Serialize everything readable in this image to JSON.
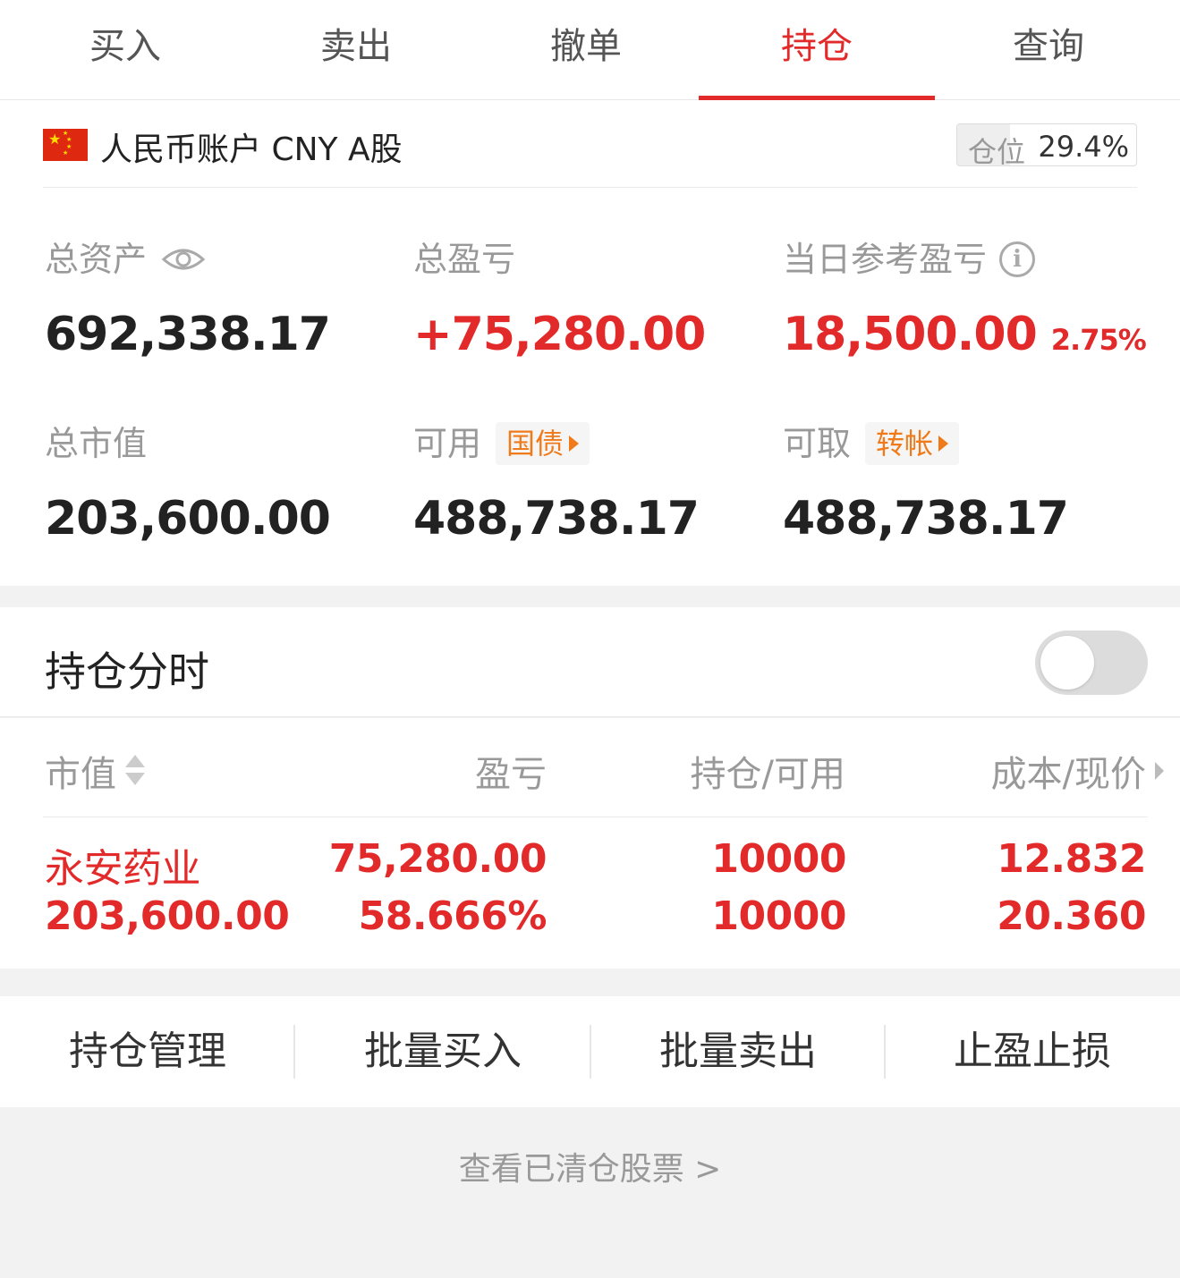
{
  "tabs": [
    {
      "label": "买入"
    },
    {
      "label": "卖出"
    },
    {
      "label": "撤单"
    },
    {
      "label": "持仓",
      "active": true
    },
    {
      "label": "查询"
    }
  ],
  "account": {
    "name": "人民币账户 CNY A股",
    "flag_icon": "china-flag-icon",
    "position_label": "仓位",
    "position_value": "29.4%",
    "position_ratio": 0.294
  },
  "stats": {
    "total_assets": {
      "label": "总资产",
      "value": "692,338.17"
    },
    "total_pnl": {
      "label": "总盈亏",
      "value": "+75,280.00"
    },
    "daily_pnl": {
      "label": "当日参考盈亏",
      "value": "18,500.00",
      "pct": "2.75%"
    },
    "market_value": {
      "label": "总市值",
      "value": "203,600.00"
    },
    "available": {
      "label": "可用",
      "value": "488,738.17",
      "tag": "国债"
    },
    "withdrawable": {
      "label": "可取",
      "value": "488,738.17",
      "tag": "转帐"
    }
  },
  "timeshare": {
    "title": "持仓分时",
    "enabled": false
  },
  "holdings": {
    "headers": {
      "market_value": "市值",
      "pnl": "盈亏",
      "position": "持仓/可用",
      "cost": "成本/现价"
    },
    "rows": [
      {
        "name": "永安药业",
        "market_value": "203,600.00",
        "pnl": "75,280.00",
        "pnl_pct": "58.666%",
        "position": "10000",
        "available": "10000",
        "cost": "12.832",
        "price": "20.360"
      }
    ]
  },
  "actions": [
    "持仓管理",
    "批量买入",
    "批量卖出",
    "止盈止损"
  ],
  "footer": {
    "cleared_link": "查看已清仓股票 >"
  },
  "colors": {
    "accent": "#e32a2a",
    "tag_orange": "#f07a1a",
    "muted": "#999999"
  }
}
